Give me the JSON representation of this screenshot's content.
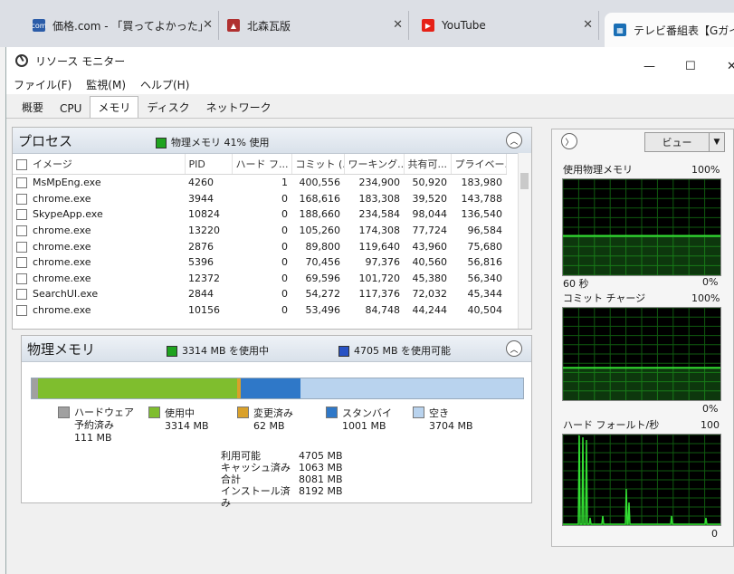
{
  "browser_tabs": [
    {
      "label": "価格.com - 「買ってよかった」",
      "icon": "kakaku-favicon",
      "color": "#2b5ca8"
    },
    {
      "label": "北森瓦版",
      "icon": "hokushin-favicon",
      "color": "#b03030"
    },
    {
      "label": "YouTube",
      "icon": "youtube-favicon",
      "color": "#e62117"
    },
    {
      "label": "テレビ番組表【Gガイド】",
      "icon": "tv-guide-favicon",
      "color": "#1a6fb5"
    }
  ],
  "window": {
    "title": "リソース モニター",
    "controls": {
      "minimize": "—",
      "maximize": "☐",
      "close": "✕"
    }
  },
  "menu": [
    "ファイル(F)",
    "監視(M)",
    "ヘルプ(H)"
  ],
  "tabs": [
    "概要",
    "CPU",
    "メモリ",
    "ディスク",
    "ネットワーク"
  ],
  "active_tab": "メモリ",
  "process_panel": {
    "title": "プロセス",
    "summary": "物理メモリ 41% 使用",
    "columns": [
      "イメージ",
      "PID",
      "ハード フ...",
      "コミット (...",
      "ワーキング...",
      "共有可...",
      "プライベー..."
    ],
    "rows": [
      [
        "MsMpEng.exe",
        "4260",
        "1",
        "400,556",
        "234,900",
        "50,920",
        "183,980"
      ],
      [
        "chrome.exe",
        "3944",
        "0",
        "168,616",
        "183,308",
        "39,520",
        "143,788"
      ],
      [
        "SkypeApp.exe",
        "10824",
        "0",
        "188,660",
        "234,584",
        "98,044",
        "136,540"
      ],
      [
        "chrome.exe",
        "13220",
        "0",
        "105,260",
        "174,308",
        "77,724",
        "96,584"
      ],
      [
        "chrome.exe",
        "2876",
        "0",
        "89,800",
        "119,640",
        "43,960",
        "75,680"
      ],
      [
        "chrome.exe",
        "5396",
        "0",
        "70,456",
        "97,376",
        "40,560",
        "56,816"
      ],
      [
        "chrome.exe",
        "12372",
        "0",
        "69,596",
        "101,720",
        "45,380",
        "56,340"
      ],
      [
        "SearchUI.exe",
        "2844",
        "0",
        "54,272",
        "117,376",
        "72,032",
        "45,344"
      ],
      [
        "chrome.exe",
        "10156",
        "0",
        "53,496",
        "84,748",
        "44,244",
        "40,504"
      ]
    ]
  },
  "physical_memory": {
    "title": "物理メモリ",
    "in_use_label": "3314 MB を使用中",
    "available_label": "4705 MB を使用可能",
    "bar_mb": {
      "reserved": 111,
      "in_use": 3314,
      "modified": 62,
      "standby": 1001,
      "free": 3704
    },
    "legend": [
      {
        "label": "ハードウェア予約済み",
        "value": "111 MB",
        "color": "#a0a0a0"
      },
      {
        "label": "使用中",
        "value": "3314 MB",
        "color": "#7fbe2e"
      },
      {
        "label": "変更済み",
        "value": "62 MB",
        "color": "#d9a12b"
      },
      {
        "label": "スタンバイ",
        "value": "1001 MB",
        "color": "#2f78c8"
      },
      {
        "label": "空き",
        "value": "3704 MB",
        "color": "#b9d3ee"
      }
    ],
    "stats": [
      {
        "k": "利用可能",
        "v": "4705 MB"
      },
      {
        "k": "キャッシュ済み",
        "v": "1063 MB"
      },
      {
        "k": "合計",
        "v": "8081 MB"
      },
      {
        "k": "インストール済み",
        "v": "8192 MB"
      }
    ]
  },
  "right_panel": {
    "view_label": "ビュー",
    "graphs": [
      {
        "title": "使用物理メモリ",
        "max": "100%",
        "bl": "60 秒",
        "br": "0%",
        "level": 0.41
      },
      {
        "title": "コミット チャージ",
        "max": "100%",
        "br": "0%",
        "level": 0.35
      },
      {
        "title": "ハード フォールト/秒",
        "max": "100",
        "br": "0"
      }
    ]
  },
  "colors": {
    "graph_line": "#33dd33",
    "graph_grid": "#0f5a0f",
    "in_use_swatch": "#1fa31f",
    "available_swatch": "#2852c4"
  }
}
